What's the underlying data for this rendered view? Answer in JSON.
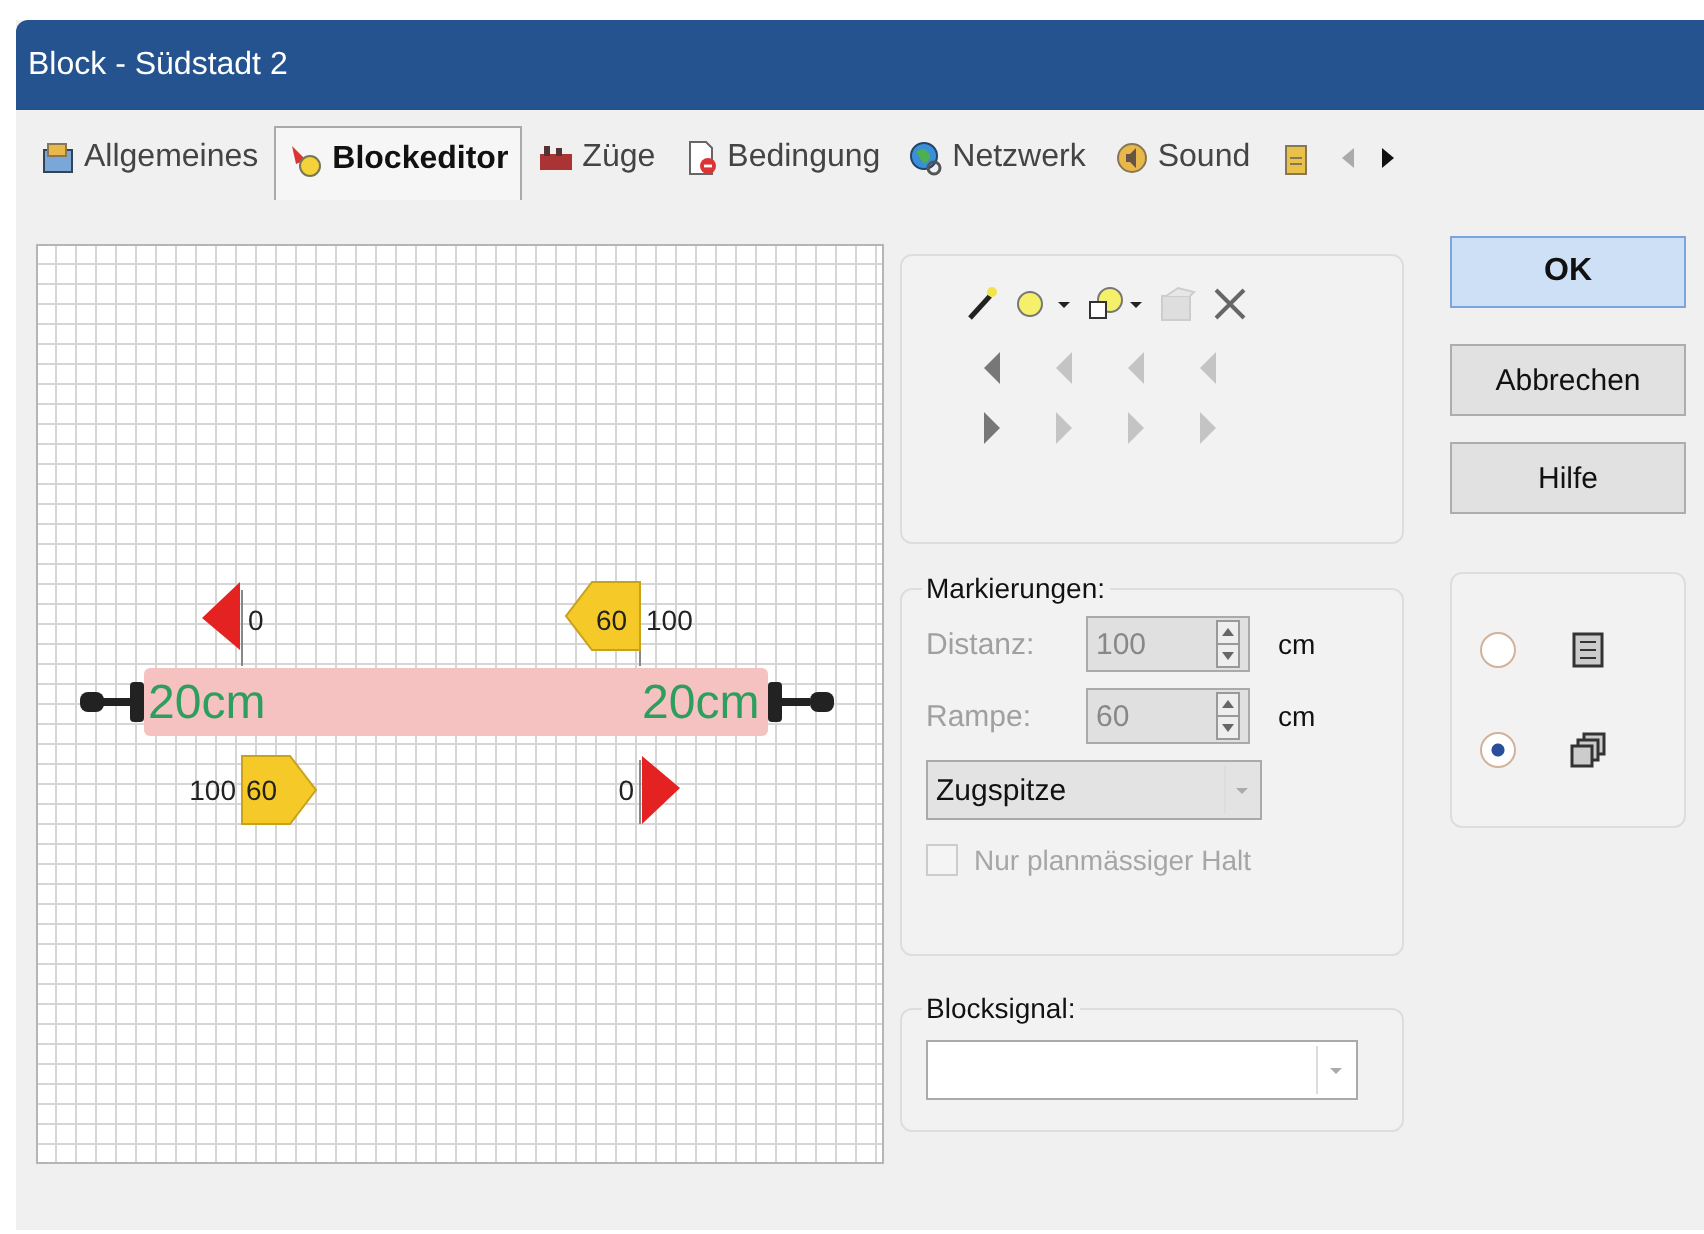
{
  "window": {
    "title": "Block - Südstadt 2"
  },
  "tabs": [
    {
      "label": "Allgemeines",
      "selected": false
    },
    {
      "label": "Blockeditor",
      "selected": true
    },
    {
      "label": "Züge",
      "selected": false
    },
    {
      "label": "Bedingung",
      "selected": false
    },
    {
      "label": "Netzwerk",
      "selected": false
    },
    {
      "label": "Sound",
      "selected": false
    },
    {
      "selected": false
    }
  ],
  "editor": {
    "distance_labels": [
      "20cm",
      "20cm"
    ],
    "markers": [
      {
        "kind": "stop",
        "value": "0"
      },
      {
        "kind": "ramp",
        "badge": "60",
        "value": "100"
      },
      {
        "kind": "ramp",
        "badge": "60",
        "value": "100"
      },
      {
        "kind": "stop",
        "value": "0"
      }
    ]
  },
  "toolbar": [
    {
      "kind": "wand",
      "disabled": false
    },
    {
      "kind": "circle",
      "disabled": false
    },
    {
      "kind": "shape",
      "disabled": false
    },
    {
      "kind": "properties",
      "disabled": true
    },
    {
      "kind": "delete",
      "disabled": false
    }
  ],
  "arrow_rows": [
    {
      "buttons": [
        {
          "disabled": false
        },
        {
          "disabled": true
        },
        {
          "disabled": true
        },
        {
          "disabled": true
        }
      ]
    },
    {
      "buttons": [
        {
          "disabled": false
        },
        {
          "disabled": true
        },
        {
          "disabled": true
        },
        {
          "disabled": true
        }
      ]
    }
  ],
  "markings": {
    "title": "Markierungen:",
    "fields": [
      {
        "label": "Distanz:",
        "value": "100",
        "unit": "cm",
        "disabled": true
      },
      {
        "label": "Rampe:",
        "value": "60",
        "unit": "cm",
        "disabled": true
      }
    ],
    "dropdown": {
      "value": "Zugspitze"
    },
    "checkbox": {
      "label": "Nur planmässiger Halt",
      "checked": false,
      "disabled": true
    }
  },
  "block_signal": {
    "title": "Blocksignal:"
  },
  "buttons": [
    {
      "label": "OK",
      "default": true
    },
    {
      "label": "Abbrechen",
      "default": false
    },
    {
      "label": "Hilfe",
      "default": false
    }
  ],
  "view_options": [
    {
      "selected": false
    },
    {
      "selected": true
    }
  ]
}
